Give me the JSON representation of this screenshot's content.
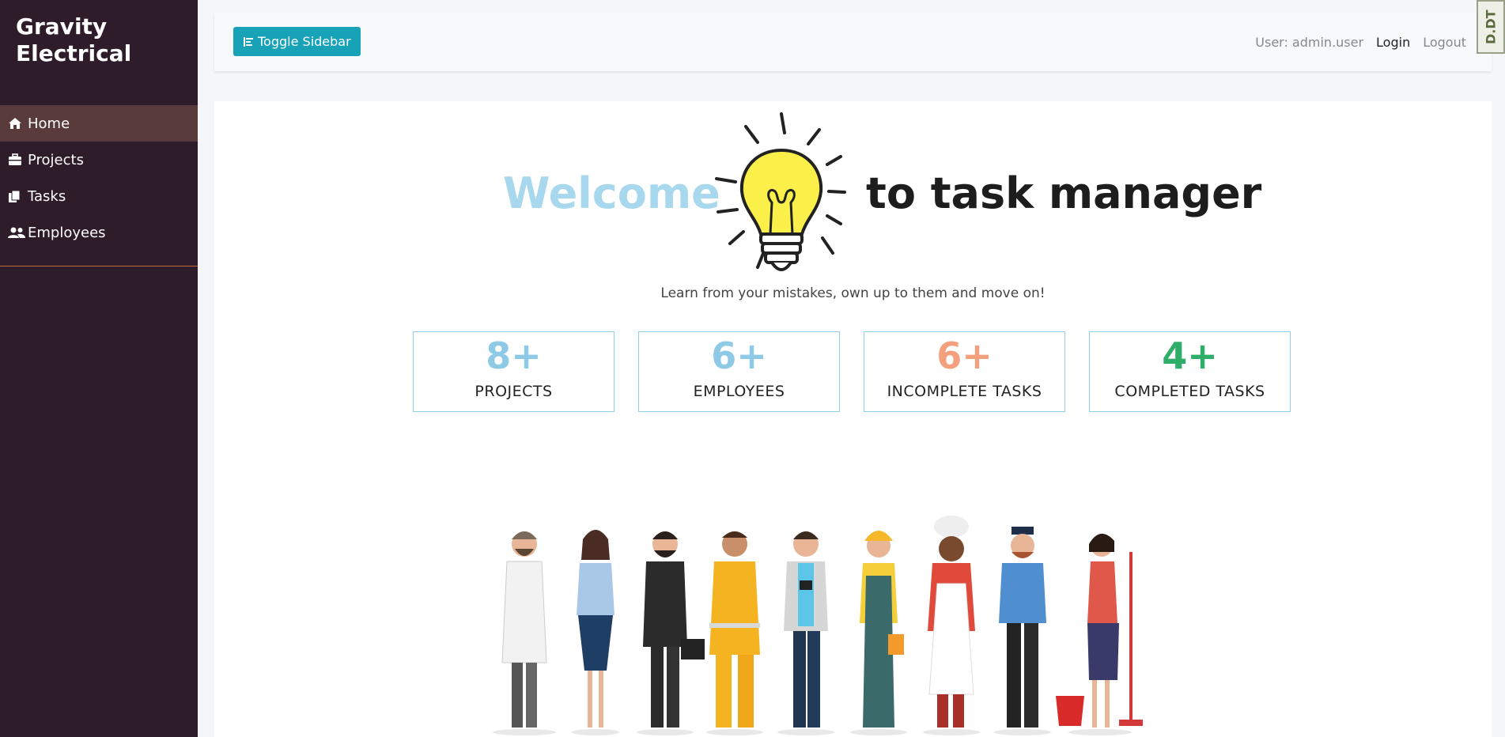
{
  "sidebar": {
    "brand": "Gravity Electrical",
    "items": [
      {
        "label": "Home",
        "icon": "home-icon",
        "active": true
      },
      {
        "label": "Projects",
        "icon": "briefcase-icon",
        "active": false
      },
      {
        "label": "Tasks",
        "icon": "files-icon",
        "active": false
      },
      {
        "label": "Employees",
        "icon": "users-icon",
        "active": false
      }
    ]
  },
  "topbar": {
    "toggle_label": "Toggle Sidebar",
    "user_text": "User: admin.user",
    "login_label": "Login",
    "logout_label": "Logout",
    "badge_text": "D.DT"
  },
  "hero": {
    "welcome": "Welcome",
    "title_rest": "to task manager",
    "tagline": "Learn from your mistakes, own up to them and move on!"
  },
  "stats": [
    {
      "value": "8+",
      "label": "PROJECTS",
      "color": "#8ecae6"
    },
    {
      "value": "6+",
      "label": "EMPLOYEES",
      "color": "#8ecae6"
    },
    {
      "value": "6+",
      "label": "INCOMPLETE TASKS",
      "color": "#f4a07e"
    },
    {
      "value": "4+",
      "label": "COMPLETED TASKS",
      "color": "#2fae6a"
    }
  ],
  "colors": {
    "sidebar_bg": "#2f1c2b",
    "sidebar_active": "#5a3b3c",
    "accent": "#17a2b8"
  }
}
